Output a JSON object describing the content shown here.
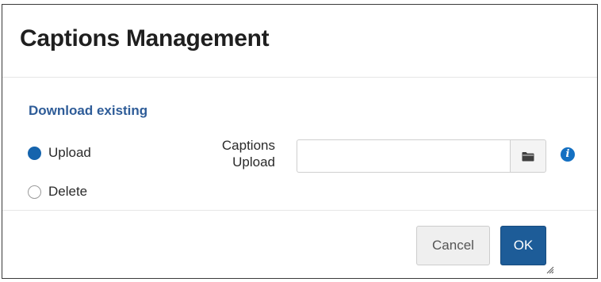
{
  "dialog": {
    "title": "Captions Management"
  },
  "body": {
    "download_link": "Download existing",
    "radio_options": [
      {
        "label": "Upload",
        "checked": true
      },
      {
        "label": "Delete",
        "checked": false
      }
    ],
    "field_label": "Captions Upload",
    "file_input": {
      "value": "",
      "placeholder": ""
    },
    "browse_icon": "folder-icon",
    "info_icon": "info-icon"
  },
  "footer": {
    "cancel_label": "Cancel",
    "ok_label": "OK"
  },
  "colors": {
    "primary": "#1D5C98",
    "link": "#2E5C98",
    "radio_checked": "#1564AD",
    "info": "#1470C2"
  }
}
